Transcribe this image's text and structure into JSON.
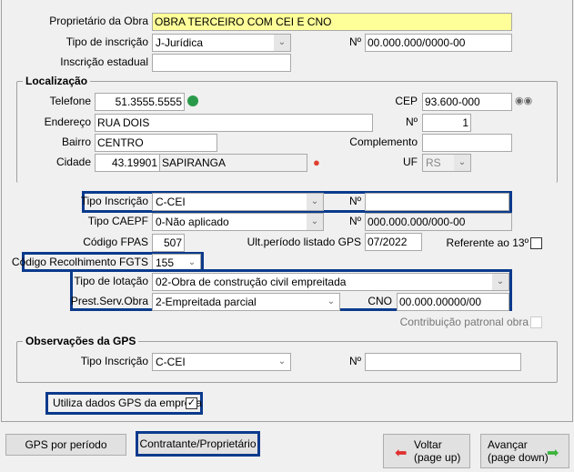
{
  "owner": {
    "label": "Proprietário da Obra",
    "value": "OBRA TERCEIRO COM CEI E CNO"
  },
  "tipo_inscricao": {
    "label": "Tipo de inscrição",
    "value": "J-Jurídica",
    "num_label": "Nº",
    "num_value": "00.000.000/0000-00"
  },
  "inscricao_estadual": {
    "label": "Inscrição estadual",
    "value": ""
  },
  "localizacao": {
    "title": "Localização",
    "telefone_label": "Telefone",
    "telefone": "51.3555.5555",
    "cep_label": "CEP",
    "cep": "93.600-000",
    "endereco_label": "Endereço",
    "endereco": "RUA DOIS",
    "numero_label": "Nº",
    "numero": "1",
    "bairro_label": "Bairro",
    "bairro": "CENTRO",
    "complemento_label": "Complemento",
    "complemento": "",
    "cidade_label": "Cidade",
    "cidade_codigo": "43.19901",
    "cidade_nome": "SAPIRANGA",
    "uf_label": "UF",
    "uf": "RS"
  },
  "gps": {
    "tipo_inscricao_label": "Tipo Inscrição",
    "tipo_inscricao": "C-CEI",
    "num_label": "Nº",
    "num_value": "",
    "tipo_caepf_label": "Tipo CAEPF",
    "tipo_caepf": "0-Não aplicado",
    "caepf_num_label": "Nº",
    "caepf_num": "000.000.000/000-00",
    "fpas_label": "Código FPAS",
    "fpas": "507",
    "ult_periodo_label": "Ult.período listado GPS",
    "ult_periodo": "07/2022",
    "ref13_label": "Referente ao 13º",
    "ref13_checked": false,
    "fgts_label": "Código Recolhimento FGTS",
    "fgts": "155",
    "lotacao_label": "Tipo de lotação",
    "lotacao": "02-Obra de construção civil empreitada",
    "prest_label": "Prest.Serv.Obra",
    "prest": "2-Empreitada parcial",
    "cno_label": "CNO",
    "cno": "00.000.00000/00",
    "contrib_label": "Contribuição patronal obra",
    "contrib_checked": false
  },
  "observacoes": {
    "title": "Observações da GPS",
    "tipo_inscricao_label": "Tipo Inscrição",
    "tipo_inscricao": "C-CEI",
    "num_label": "Nº",
    "num_value": ""
  },
  "utiliza": {
    "label": "Utiliza dados GPS da empresa",
    "checked": true
  },
  "buttons": {
    "gps_periodo": "GPS por período",
    "contratante": "Contratante/Proprietário",
    "voltar": "Voltar",
    "voltar_sub": "(page up)",
    "avancar": "Avançar",
    "avancar_sub": "(page down)"
  },
  "colors": {
    "highlight": "#0a3a8c",
    "owner_bg": "#ffff99"
  }
}
